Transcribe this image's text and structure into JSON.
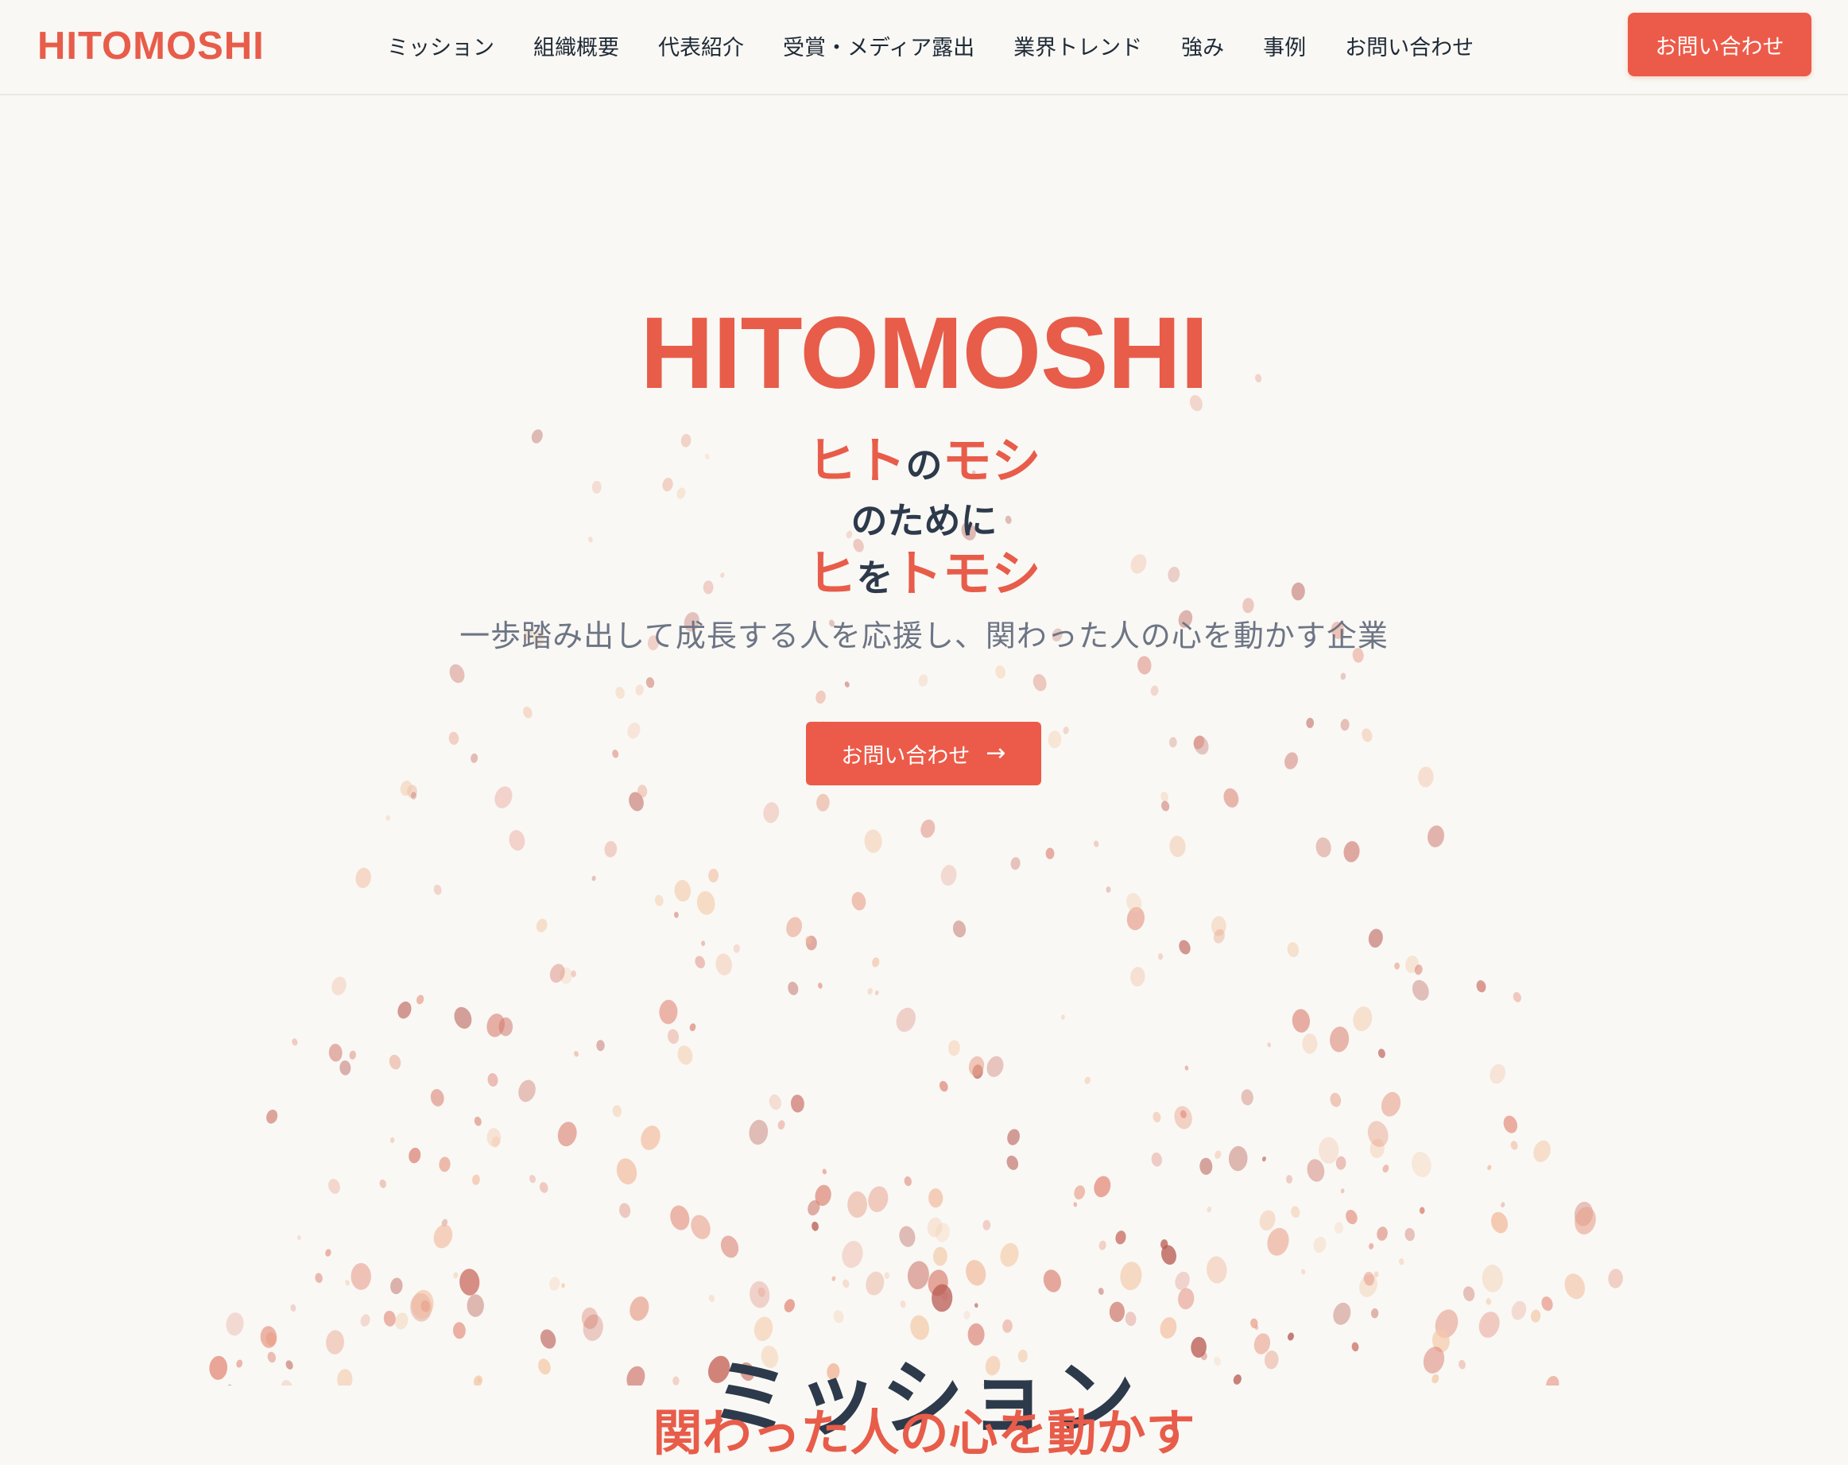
{
  "header": {
    "logo": "HITOMOSHI",
    "nav": [
      {
        "label": "ミッション"
      },
      {
        "label": "組織概要"
      },
      {
        "label": "代表紹介"
      },
      {
        "label": "受賞・メディア露出"
      },
      {
        "label": "業界トレンド"
      },
      {
        "label": "強み"
      },
      {
        "label": "事例"
      },
      {
        "label": "お問い合わせ"
      }
    ],
    "cta_label": "お問い合わせ"
  },
  "hero": {
    "title": "HITOMOSHI",
    "tagline": {
      "line1": {
        "a": "ヒト",
        "b": "の",
        "c": "モシ"
      },
      "line2": "のために",
      "line3": {
        "a": "ヒ",
        "b": "を",
        "c": "トモシ"
      }
    },
    "subtitle": "一歩踏み出して成長する人を応援し、関わった人の心を動かす企業",
    "cta_label": "お問い合わせ",
    "cta_icon": "arrow-right-icon"
  },
  "mission": {
    "heading": "ミッション",
    "subheading": "関わった人の心を動かす"
  },
  "colors": {
    "accent": "#ec5b49",
    "text_dark": "#2d3a4b",
    "text_muted": "#6d7585",
    "background": "#f9f8f4"
  }
}
